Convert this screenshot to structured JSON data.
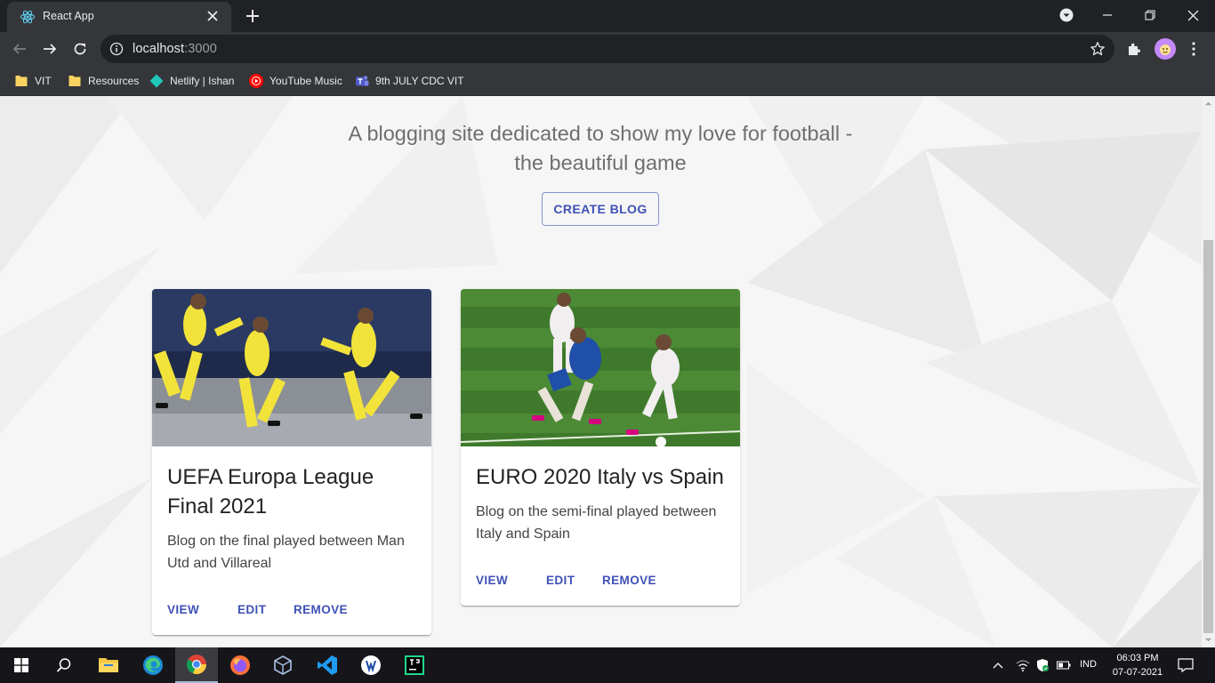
{
  "browser": {
    "tab_title": "React App",
    "url_host": "localhost",
    "url_port": ":3000",
    "bookmarks": [
      {
        "label": "VIT",
        "icon": "folder-icon"
      },
      {
        "label": "Resources",
        "icon": "folder-icon"
      },
      {
        "label": "Netlify | Ishan",
        "icon": "netlify-icon"
      },
      {
        "label": "YouTube Music",
        "icon": "youtube-music-icon"
      },
      {
        "label": "9th JULY CDC VIT",
        "icon": "teams-icon"
      }
    ]
  },
  "page": {
    "tagline": "A blogging site dedicated to show my love for football - the beautiful game",
    "create_button": "CREATE BLOG",
    "accent_color": "#3f51b5",
    "cards": [
      {
        "title": "UEFA Europa League Final 2021",
        "description": "Blog on the final played between Man Utd and Villareal",
        "actions": [
          "VIEW",
          "EDIT",
          "REMOVE"
        ]
      },
      {
        "title": "EURO 2020 Italy vs Spain",
        "description": "Blog on the semi-final played between Italy and Spain",
        "actions": [
          "VIEW",
          "EDIT",
          "REMOVE"
        ]
      }
    ]
  },
  "taskbar": {
    "language": "IND",
    "time": "06:03 PM",
    "date": "07-07-2021"
  }
}
